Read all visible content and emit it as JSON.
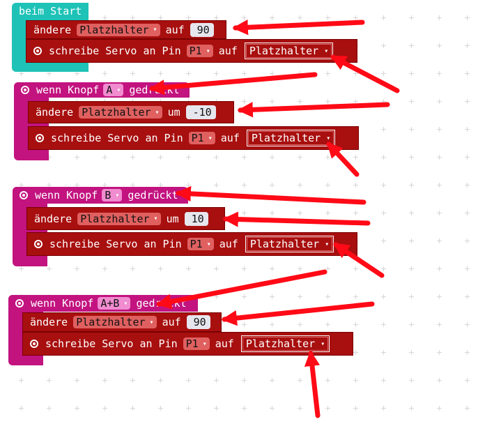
{
  "start_block": {
    "label": "beim Start",
    "color": "#1ec2b7",
    "change": {
      "verb": "ändere",
      "variable": "Platzhalter",
      "preposition": "auf",
      "value": "90"
    },
    "servo": {
      "text": "schreibe Servo an Pin",
      "pin": "P1",
      "preposition": "auf",
      "variable": "Platzhalter"
    }
  },
  "button_blocks": [
    {
      "prefix": "wenn Knopf",
      "button": "A",
      "suffix": "gedrückt",
      "change": {
        "verb": "ändere",
        "variable": "Platzhalter",
        "preposition": "um",
        "value": "-10"
      },
      "servo": {
        "text": "schreibe Servo an Pin",
        "pin": "P1",
        "preposition": "auf",
        "variable": "Platzhalter"
      }
    },
    {
      "prefix": "wenn Knopf",
      "button": "B",
      "suffix": "gedrückt",
      "change": {
        "verb": "ändere",
        "variable": "Platzhalter",
        "preposition": "um",
        "value": "10"
      },
      "servo": {
        "text": "schreibe Servo an Pin",
        "pin": "P1",
        "preposition": "auf",
        "variable": "Platzhalter"
      }
    },
    {
      "prefix": "wenn Knopf",
      "button": "A+B",
      "suffix": "gedrückt",
      "change": {
        "verb": "ändere",
        "variable": "Platzhalter",
        "preposition": "auf",
        "value": "90"
      },
      "servo": {
        "text": "schreibe Servo an Pin",
        "pin": "P1",
        "preposition": "auf",
        "variable": "Platzhalter"
      }
    }
  ],
  "colors": {
    "teal": "#1ec2b7",
    "magenta": "#c2137f",
    "dark_red": "#a80f0f",
    "annotation_red": "#ff0a16"
  }
}
